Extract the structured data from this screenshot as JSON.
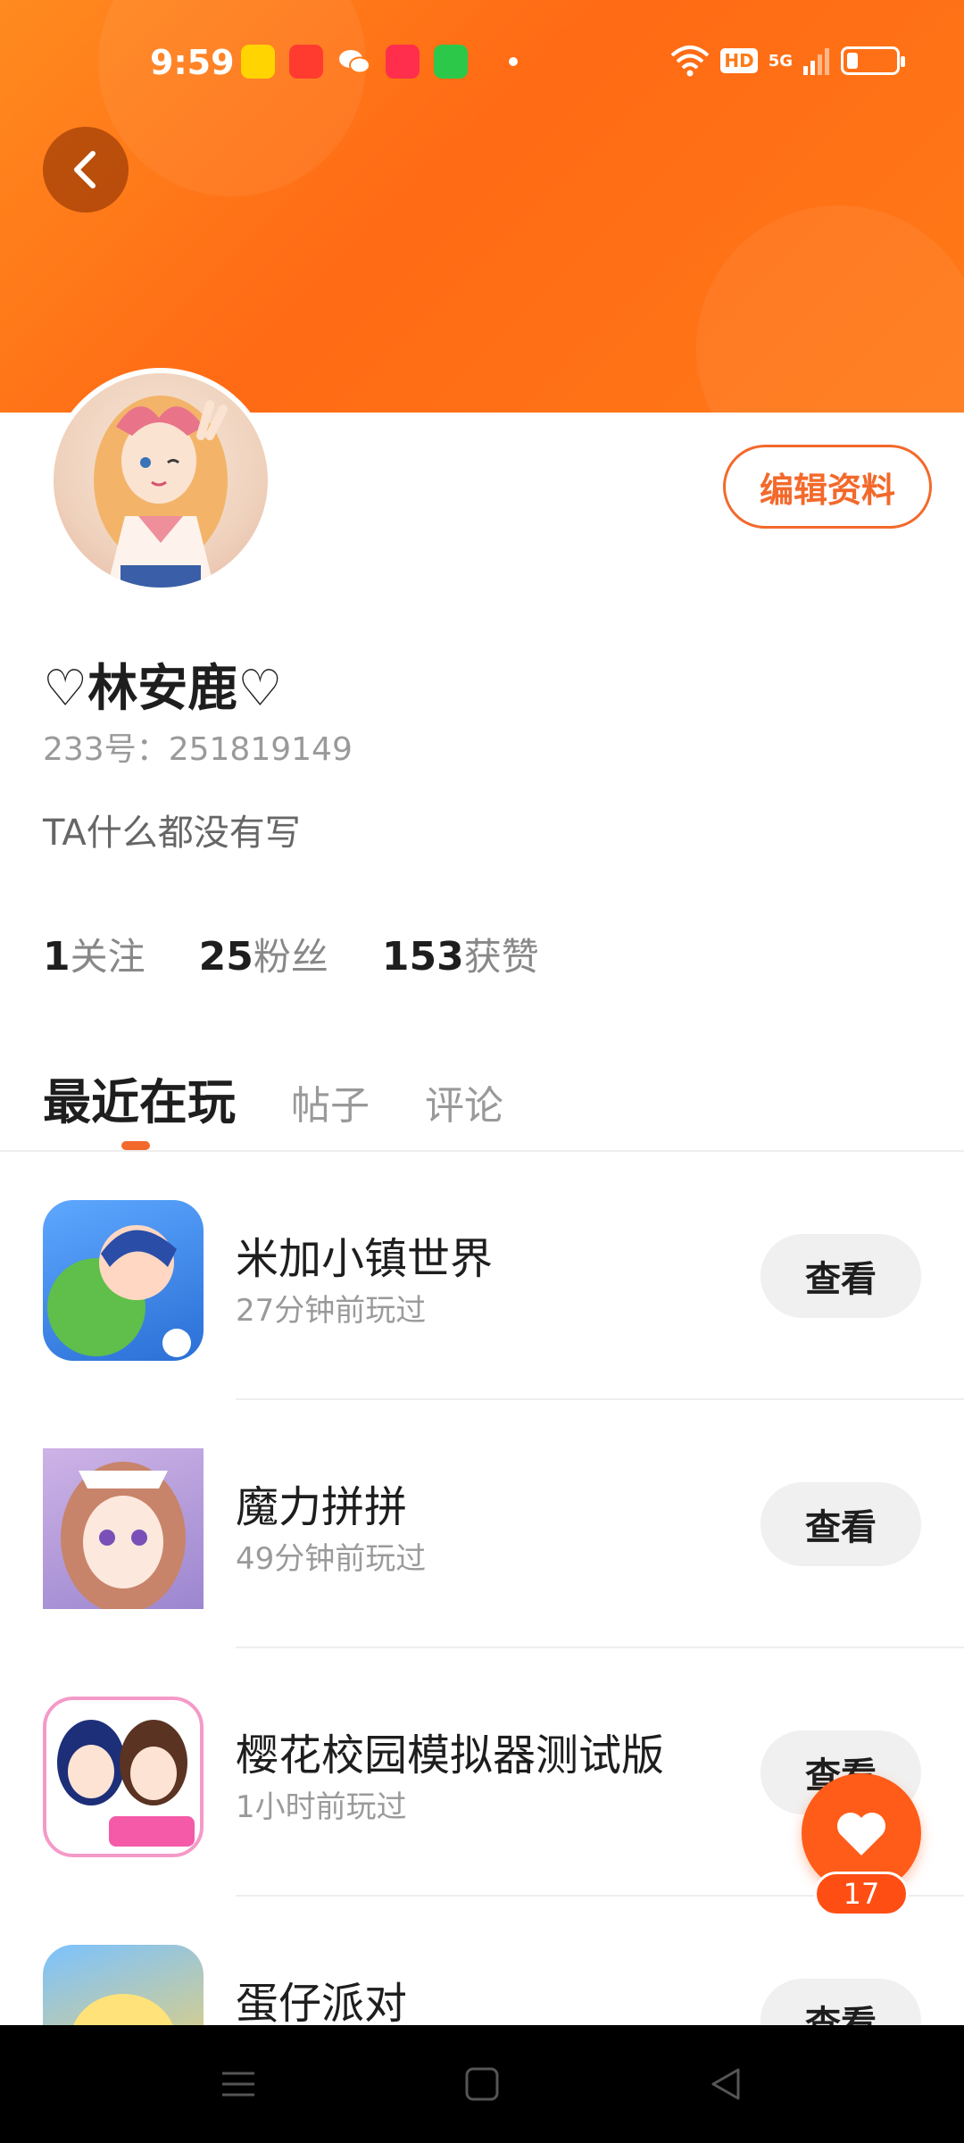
{
  "status_bar": {
    "time": "9:59",
    "app_icons": [
      "qq-browser-icon",
      "multi-app-icon",
      "wechat-icon",
      "xiaohongshu-icon",
      "store-icon"
    ],
    "hd_label": "HD",
    "network_label": "5G"
  },
  "profile": {
    "edit_label": "编辑资料",
    "username": "♡林安鹿♡",
    "uid": "233号：251819149",
    "bio": "TA什么都没有写",
    "stats": [
      {
        "num": "1",
        "label": "关注"
      },
      {
        "num": "25",
        "label": "粉丝"
      },
      {
        "num": "153",
        "label": "获赞"
      }
    ]
  },
  "tabs": [
    {
      "label": "最近在玩",
      "active": true
    },
    {
      "label": "帖子",
      "active": false
    },
    {
      "label": "评论",
      "active": false
    }
  ],
  "games": [
    {
      "name": "米加小镇世界",
      "played": "27分钟前玩过",
      "button": "查看",
      "icon_color": "#6fb5ff"
    },
    {
      "name": "魔力拼拼",
      "played": "49分钟前玩过",
      "button": "查看",
      "icon_color": "#e8c8e8"
    },
    {
      "name": "樱花校园模拟器测试版",
      "played": "1小时前玩过",
      "button": "查看",
      "icon_color": "#f6a7d1"
    },
    {
      "name": "蛋仔派对",
      "played": "",
      "button": "查看",
      "icon_color": "#ffd35a"
    }
  ],
  "like": {
    "count": "17"
  },
  "colors": {
    "accent": "#f3692b",
    "banner_start": "#ff8a1f",
    "banner_end": "#ff6a14",
    "fab": "#ff5c1a"
  }
}
